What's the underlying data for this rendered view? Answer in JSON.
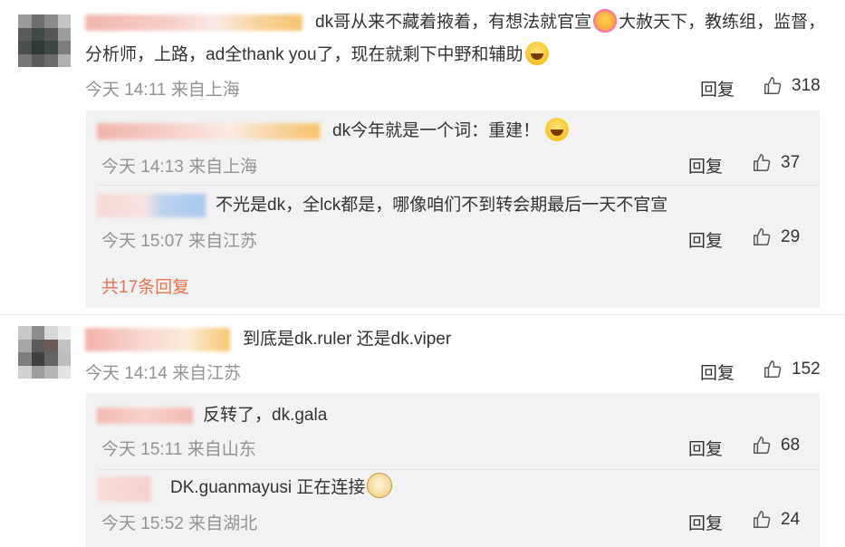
{
  "comments": [
    {
      "text_line1": "dk哥从来不藏着掖着，有想法就官宣",
      "text_line1b": "大赦天下，教练组，监督，",
      "text_line2": "分析师，上路，ad全thank you了，现在就剩下中野和辅助",
      "time": "今天 14:11 来自上海",
      "reply_label": "回复",
      "likes": "318",
      "replies": [
        {
          "text": "dk今年就是一个词：重建！",
          "time": "今天 14:13 来自上海",
          "reply_label": "回复",
          "likes": "37"
        },
        {
          "text": "不光是dk，全lck都是，哪像咱们不到转会期最后一天不官宣",
          "time": "今天 15:07 来自江苏",
          "reply_label": "回复",
          "likes": "29"
        }
      ],
      "more_replies": "共17条回复"
    },
    {
      "text_line1": "到底是dk.ruler 还是dk.viper",
      "time": "今天 14:14 来自江苏",
      "reply_label": "回复",
      "likes": "152",
      "replies": [
        {
          "text": "反转了，dk.gala",
          "time": "今天 15:11 来自山东",
          "reply_label": "回复",
          "likes": "68"
        },
        {
          "text": "DK.guanmayusi 正在连接",
          "time": "今天 15:52 来自湖北",
          "reply_label": "回复",
          "likes": "24"
        }
      ]
    }
  ],
  "icons": {
    "like": "thumbs-up-icon",
    "laugh": "laughing-emoji-icon",
    "party": "party-emoji-icon",
    "dog": "doge-emoji-icon"
  },
  "colors": {
    "more_link": "#eb7350",
    "meta": "#939393",
    "reply_bg": "#f2f2f2"
  }
}
